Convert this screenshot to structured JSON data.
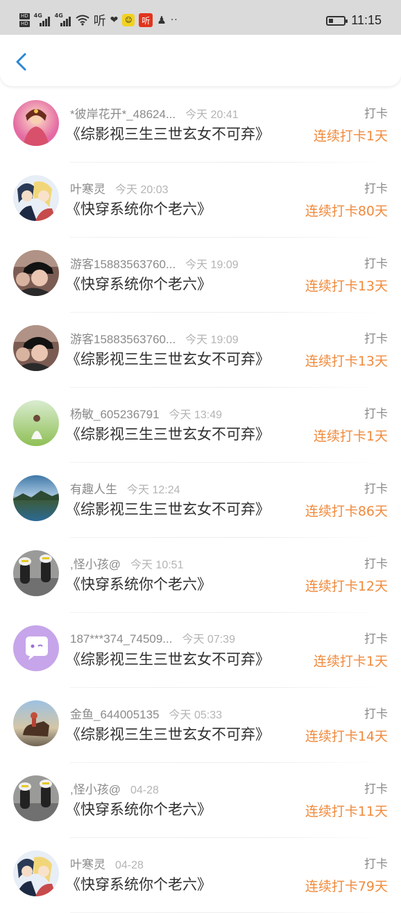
{
  "status_bar": {
    "hd1": "HD",
    "hd2": "HD",
    "net1": "4G",
    "net2": "4G",
    "ting": "听",
    "red_ting": "听",
    "dots": "··",
    "time": "11:15",
    "battery_level": 0.3
  },
  "header": {
    "back_icon": "chevron-left-icon",
    "accent": "#2b86d6"
  },
  "colors": {
    "streak": "#f08a3c",
    "name": "#8a8a8a",
    "time": "#b4b4b4",
    "title": "#2f2f2f"
  },
  "entries": [
    {
      "name": "*彼岸花开*_48624...",
      "time": "今天 20:41",
      "title": "《综影视三生三世玄女不可弃》",
      "tag": "打卡",
      "streak": "连续打卡1天",
      "avatar": "avatar-1"
    },
    {
      "name": "叶寒灵",
      "time": "今天 20:03",
      "title": "《快穿系统你个老六》",
      "tag": "打卡",
      "streak": "连续打卡80天",
      "avatar": "avatar-2"
    },
    {
      "name": "游客15883563760...",
      "time": "今天 19:09",
      "title": "《快穿系统你个老六》",
      "tag": "打卡",
      "streak": "连续打卡13天",
      "avatar": "avatar-3"
    },
    {
      "name": "游客15883563760...",
      "time": "今天 19:09",
      "title": "《综影视三生三世玄女不可弃》",
      "tag": "打卡",
      "streak": "连续打卡13天",
      "avatar": "avatar-3"
    },
    {
      "name": "杨敏_605236791",
      "time": "今天 13:49",
      "title": "《综影视三生三世玄女不可弃》",
      "tag": "打卡",
      "streak": "连续打卡1天",
      "avatar": "avatar-5"
    },
    {
      "name": "有趣人生",
      "time": "今天 12:24",
      "title": "《综影视三生三世玄女不可弃》",
      "tag": "打卡",
      "streak": "连续打卡86天",
      "avatar": "avatar-6"
    },
    {
      "name": ",怪小孩@",
      "time": "今天 10:51",
      "title": "《快穿系统你个老六》",
      "tag": "打卡",
      "streak": "连续打卡12天",
      "avatar": "avatar-7"
    },
    {
      "name": "187***374_74509...",
      "time": "今天 07:39",
      "title": "《综影视三生三世玄女不可弃》",
      "tag": "打卡",
      "streak": "连续打卡1天",
      "avatar": "avatar-8"
    },
    {
      "name": "金鱼_644005135",
      "time": "今天 05:33",
      "title": "《综影视三生三世玄女不可弃》",
      "tag": "打卡",
      "streak": "连续打卡14天",
      "avatar": "avatar-9"
    },
    {
      "name": ",怪小孩@",
      "time": "04-28",
      "title": "《快穿系统你个老六》",
      "tag": "打卡",
      "streak": "连续打卡11天",
      "avatar": "avatar-7"
    },
    {
      "name": "叶寒灵",
      "time": "04-28",
      "title": "《快穿系统你个老六》",
      "tag": "打卡",
      "streak": "连续打卡79天",
      "avatar": "avatar-2"
    }
  ]
}
